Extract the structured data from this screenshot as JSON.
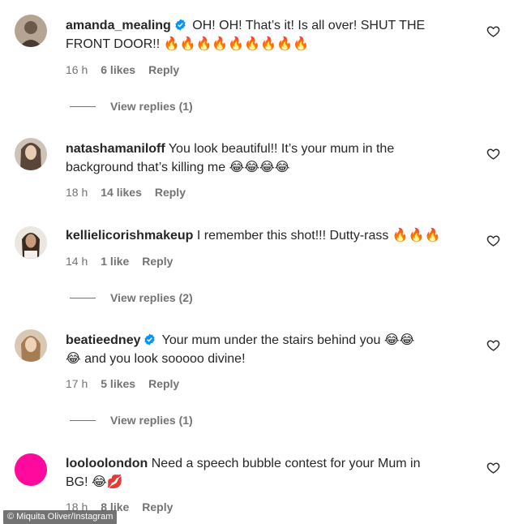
{
  "comments": [
    {
      "username": "amanda_mealing",
      "verified": true,
      "text_line1": "OH! OH! That’s it! Is all over! SHUT THE",
      "text_line2": "FRONT DOOR!!",
      "emojis": "🔥🔥🔥🔥🔥🔥🔥🔥🔥",
      "time": "16 h",
      "likes": "6 likes",
      "reply": "Reply",
      "view_replies": "View replies (1)",
      "avatar_color": "#7a6a5c"
    },
    {
      "username": "natashamaniloff",
      "verified": false,
      "text_line1": "You look beautiful!! It’s your mum in the",
      "text_line2": "background that’s killing me",
      "emojis": "😂😂😂😂",
      "time": "18 h",
      "likes": "14 likes",
      "reply": "Reply",
      "avatar_color": "#5a4638"
    },
    {
      "username": "kellielicorishmakeup",
      "verified": false,
      "text_line1": "I remember this shot!!! Dutty-rass",
      "emojis": "🔥🔥🔥",
      "time": "14 h",
      "likes": "1 like",
      "reply": "Reply",
      "view_replies": "View replies (2)",
      "avatar_color": "#8c6b55"
    },
    {
      "username": "beatieedney",
      "verified": true,
      "text_line1": "Your mum under the stairs behind you",
      "emojis_line1": "😂😂",
      "emojis_line2": "😂",
      "text_line2": "and you look sooooo divine!",
      "time": "17 h",
      "likes": "5 likes",
      "reply": "Reply",
      "view_replies": "View replies (1)",
      "avatar_color": "#b8926a"
    },
    {
      "username": "looloolondon",
      "verified": false,
      "text_line1": "Need a speech bubble contest for your Mum in",
      "text_line2": "BG!",
      "emojis": "😂💋",
      "time": "18 h",
      "likes": "8 like",
      "reply": "Reply",
      "avatar_color": "#ff0a9c"
    }
  ],
  "credit": "© Miquita Oliver/Instagram",
  "colors": {
    "text": "#262626",
    "muted": "#737373",
    "verified": "#0095f6"
  }
}
